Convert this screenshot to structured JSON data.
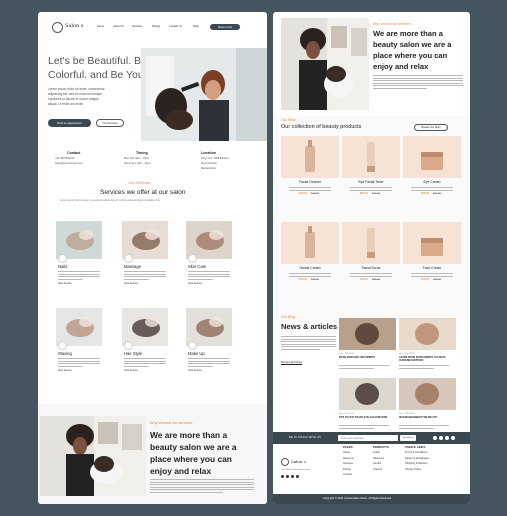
{
  "colors": {
    "frame": "#45555f",
    "accent": "#e8863a",
    "dark": "#3b4852",
    "peach": "#f6e3d6"
  },
  "brand": {
    "name": "Salon s",
    "tagline": "Our Studio, Renovation studio"
  },
  "nav": [
    "Home",
    "About Us",
    "Services",
    "Pricing",
    "Contact Us",
    "Shop"
  ],
  "nav_cta": "Reserve Now",
  "hero": {
    "title_1": "Let's be Beautiful. Be",
    "title_2": "Colorful. and Be You.",
    "desc_1": "Lorem ipsum dolor sit amet, consectetur",
    "desc_2": "adipiscing elit, sed do eiusmod tempor",
    "desc_3": "incididunt ut labore et dolore magna",
    "desc_4": "aliqua. Ut enim ad minim",
    "btn_primary": "Book an appointment",
    "btn_secondary": "Our Services"
  },
  "info": [
    {
      "title": "Contact",
      "l1": "+91 9876543210",
      "l2": "salon@yourdomain.com"
    },
    {
      "title": "Timing",
      "l1": "Mon-Sat: 9am - 10pm",
      "l2": "Sat & Sun: 9am - 11pm"
    },
    {
      "title": "Location",
      "l1": "Ring no 6, 1998 Banipur",
      "l2": "Near Mumbai,",
      "l3": "Maharashtra"
    }
  ],
  "services": {
    "kicker": "Our Services",
    "title": "Services we offer at our salon",
    "sub": "Lorem ipsum dolor sit amet, consectetur adipiscing elit, sed do eiusmod tempor incididunt ut la",
    "items": [
      {
        "name": "Nails",
        "link": "View Service"
      },
      {
        "name": "Massage",
        "link": "View Service"
      },
      {
        "name": "Skin Care",
        "link": "View Service"
      },
      {
        "name": "Waxing",
        "link": "View Service"
      },
      {
        "name": "Hair Style",
        "link": "View Service"
      },
      {
        "name": "Make Up",
        "link": "View Service"
      }
    ]
  },
  "why": {
    "kicker": "Why choose our services",
    "title_1": "We are more than a",
    "title_2": "beauty salon we are a",
    "title_3": "place where you can",
    "title_4": "enjoy and relax"
  },
  "shop": {
    "kicker": "Our Shop",
    "title": "Our collection of beauty products",
    "browse": "Browse Our Shop",
    "products": [
      {
        "name": "Facial Cleaner",
        "price": "$58.00",
        "old": "$74.00"
      },
      {
        "name": "Eye Facial Toner",
        "price": "$58.00",
        "old": "$74.00"
      },
      {
        "name": "Eye Cream",
        "price": "$58.00",
        "old": "$74.00"
      },
      {
        "name": "Hands Cream",
        "price": "$58.00",
        "old": "$74.00"
      },
      {
        "name": "Facial Scrub",
        "price": "$58.00",
        "old": "$74.00"
      },
      {
        "name": "Face Cream",
        "price": "$58.00",
        "old": "$74.00"
      }
    ]
  },
  "blog": {
    "kicker": "Our Blog",
    "title": "News & articles",
    "more": "Browse all Articles",
    "posts": [
      {
        "meta": "Hair · 12/12/2021",
        "title": "BASIC SKINCARE TREATMENTS"
      },
      {
        "meta": "Hair · 12/12/2021",
        "title": "LOREM IPSUM SUPPLEMENTS YOU MUST CONSUME EVERYDAY"
      },
      {
        "meta": "Hair · 12/12/2021",
        "title": "TIPS TO FAST TRACK EYELASH DURATION"
      },
      {
        "meta": "Hair · 12/12/2021",
        "title": "SKIN MANAGEMENT FOR BEAUTY"
      }
    ]
  },
  "touch": {
    "label": "BE IN TOUCH WITH US",
    "placeholder": "Enter your email here",
    "btn": "Join with us"
  },
  "footer": {
    "pages": {
      "head": "PAGES",
      "items": [
        "Home",
        "About Us",
        "Services",
        "Pricing",
        "Contact"
      ]
    },
    "products": {
      "head": "PRODUCTS",
      "items": [
        "Lotion",
        "Shampoo",
        "Scrubs",
        "Creams"
      ]
    },
    "links": {
      "head": "USEFUL LINKS",
      "items": [
        "Terms & Conditions",
        "Return & Exchanges",
        "Shipping & Delivery",
        "Privacy Policy"
      ]
    },
    "copyright": "Copyright © 2021 | Snow Flake Online. All Rights Reserved."
  }
}
